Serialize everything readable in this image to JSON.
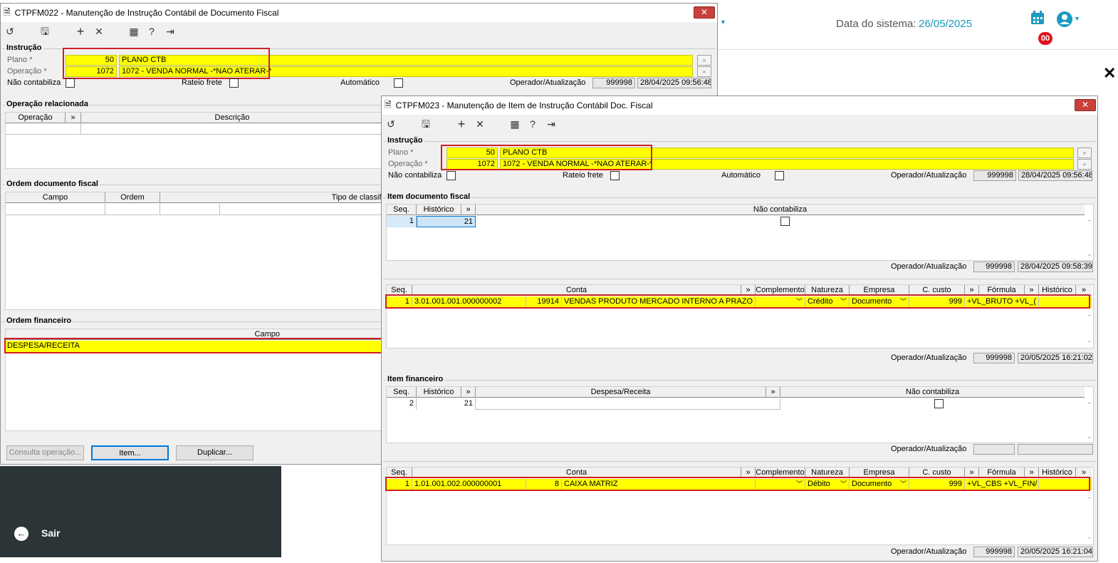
{
  "header": {
    "system_date_label": "Data do sistema:",
    "system_date_value": "26/05/2025",
    "notif_count": "00",
    "sidebar_exit": "Sair",
    "accent": "#1a9bbf"
  },
  "win1": {
    "title": "CTPFM022 - Manutenção de Instrução Contábil de Documento Fiscal",
    "close": "✕",
    "instrucao": {
      "legend": "Instrução",
      "plano_label": "Plano *",
      "plano_code": "50",
      "plano_desc": "PLANO CTB",
      "operacao_label": "Operação *",
      "operacao_code": "1072",
      "operacao_desc": "1072 - VENDA NORMAL -*NAO ATERAR-*",
      "nao_contabiliza": "Não contabiliza",
      "rateio_frete": "Rateio frete",
      "automatico": "Automático",
      "operador_label": "Operador/Atualização",
      "operador": "999998",
      "atualizacao": "28/04/2025 09:56:48"
    },
    "op_relacionada": {
      "legend": "Operação relacionada",
      "col_operacao": "Operação",
      "col_arrow": "»",
      "col_descricao": "Descrição"
    },
    "ordem_doc": {
      "legend": "Ordem documento fiscal",
      "col_campo": "Campo",
      "col_ordem": "Ordem",
      "col_tipo": "Tipo de classifi"
    },
    "ordem_fin": {
      "legend": "Ordem financeiro",
      "col_campo": "Campo",
      "row": "DESPESA/RECEITA"
    },
    "buttons": {
      "consulta": "Consulta operação...",
      "item": "Item...",
      "duplicar": "Duplicar..."
    }
  },
  "win2": {
    "title": "CTPFM023 - Manutenção de Item de Instrução Contábil Doc. Fiscal",
    "close": "✕",
    "instrucao": {
      "legend": "Instrução",
      "plano_label": "Plano *",
      "plano_code": "50",
      "plano_desc": "PLANO CTB",
      "operacao_label": "Operação *",
      "operacao_code": "1072",
      "operacao_desc": "1072 - VENDA NORMAL -*NAO ATERAR-*",
      "nao_contabiliza": "Não contabiliza",
      "rateio_frete": "Rateio frete",
      "automatico": "Automático",
      "operador_label": "Operador/Atualização",
      "operador": "999998",
      "atualizacao": "28/04/2025 09:56:48"
    },
    "item_doc": {
      "legend": "Item documento fiscal",
      "col_seq": "Seq.",
      "col_historico": "Histórico",
      "col_arrow": "»",
      "col_nao_contabiliza": "Não contabiliza",
      "row_seq": "1",
      "row_historico": "21",
      "operador_label": "Operador/Atualização",
      "operador": "999998",
      "atualizacao": "28/04/2025 09:58:39"
    },
    "conta_doc": {
      "col_seq": "Seq.",
      "col_conta": "Conta",
      "col_arrow": "»",
      "col_complemento": "Complemento",
      "col_natureza": "Natureza",
      "col_empresa": "Empresa",
      "col_ccusto": "C. custo",
      "col_formula": "Fórmula",
      "col_historico": "Histórico",
      "row_seq": "1",
      "row_conta": "3.01.001.001.000000002",
      "row_reduzida": "19914",
      "row_desc": "VENDAS PRODUTO MERCADO INTERNO A PRAZO",
      "row_natureza": "Crédito",
      "row_empresa": "Documento",
      "row_ccusto": "999",
      "row_formula": "+VL_BRUTO +VL_(",
      "operador_label": "Operador/Atualização",
      "operador": "999998",
      "atualizacao": "20/05/2025 16:21:02"
    },
    "item_fin": {
      "legend": "Item financeiro",
      "col_seq": "Seq.",
      "col_historico": "Histórico",
      "col_arrow": "»",
      "col_despesa": "Despesa/Receita",
      "col_nao_contabiliza": "Não contabiliza",
      "row_seq": "2",
      "row_historico": "21",
      "operador_label": "Operador/Atualização"
    },
    "conta_fin": {
      "col_seq": "Seq.",
      "col_conta": "Conta",
      "col_arrow": "»",
      "col_complemento": "Complemento",
      "col_natureza": "Natureza",
      "col_empresa": "Empresa",
      "col_ccusto": "C. custo",
      "col_formula": "Fórmula",
      "col_historico": "Histórico",
      "row_seq": "1",
      "row_conta": "1.01.001.002.000000001",
      "row_reduzida": "8",
      "row_desc": "CAIXA MATRIZ",
      "row_natureza": "Débito",
      "row_empresa": "Documento",
      "row_ccusto": "999",
      "row_formula": "+VL_CBS +VL_FIN/",
      "operador_label": "Operador/Atualização",
      "operador": "999998",
      "atualizacao": "20/05/2025 16:21:04"
    }
  }
}
